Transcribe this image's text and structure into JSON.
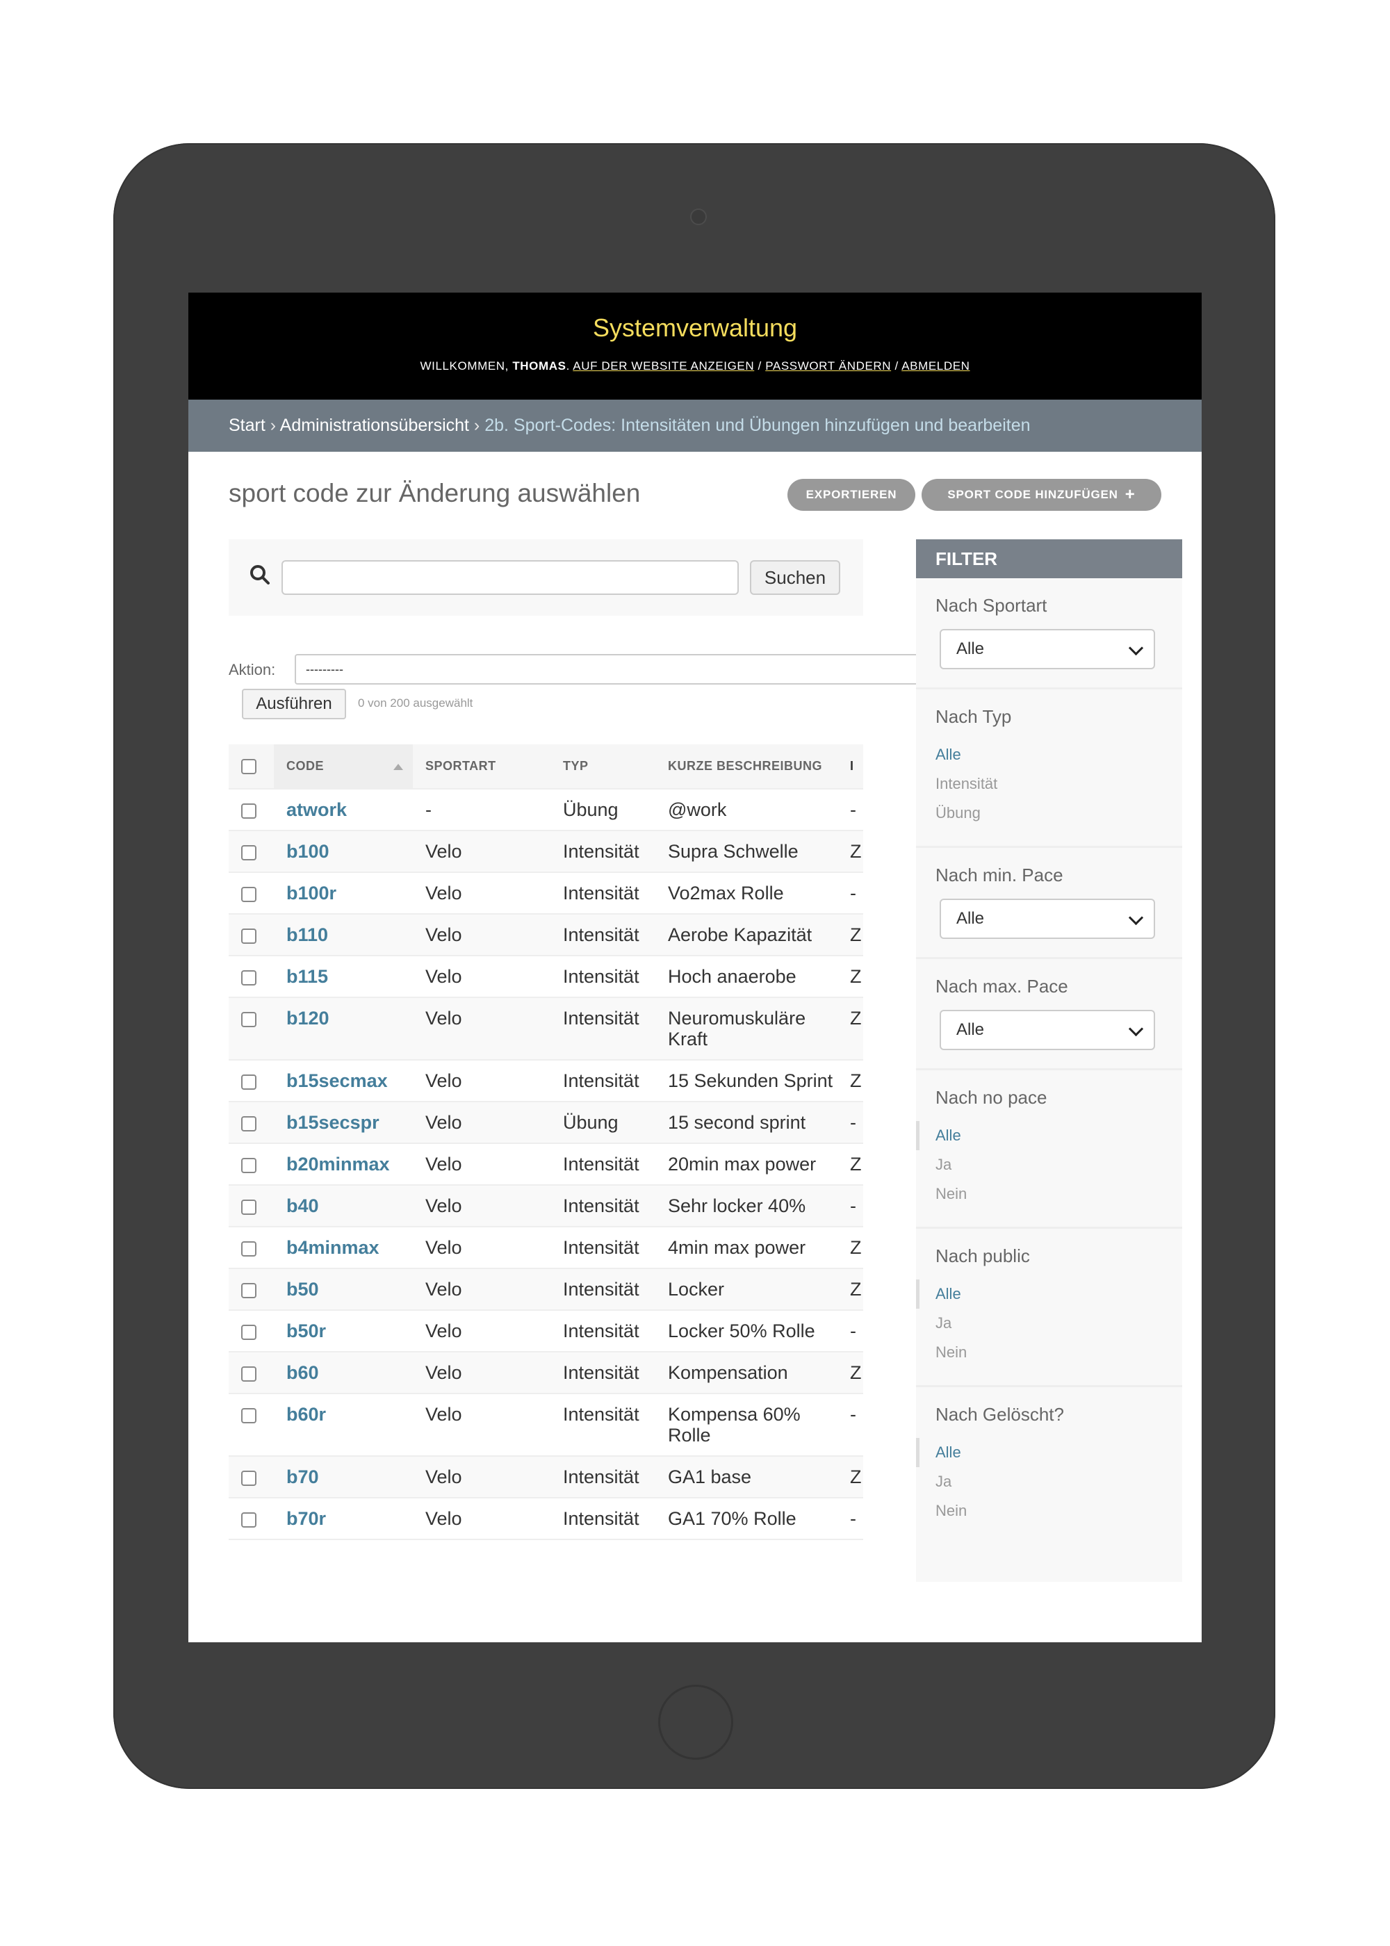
{
  "header": {
    "site_name": "Systemverwaltung",
    "welcome": "WILLKOMMEN, ",
    "username": "THOMAS",
    "after_name": ". ",
    "view_site": "AUF DER WEBSITE ANZEIGEN",
    "sep1": " / ",
    "change_password": "PASSWORT ÄNDERN",
    "sep2": " / ",
    "logout": "ABMELDEN"
  },
  "breadcrumbs": {
    "home": "Start",
    "sep": " › ",
    "app": "Administrationsübersicht",
    "current": "2b. Sport-Codes: Intensitäten und Übungen hinzufügen und bearbeiten"
  },
  "page": {
    "title": "sport code zur Änderung auswählen",
    "export_label": "EXPORTIEREN",
    "add_label": "SPORT CODE HINZUFÜGEN",
    "add_icon": "+"
  },
  "search": {
    "value": "",
    "placeholder": "",
    "button_label": "Suchen"
  },
  "actions": {
    "label": "Aktion:",
    "selected_value": "---------",
    "run_label": "Ausführen",
    "counter": "0 von 200 ausgewählt"
  },
  "table": {
    "headers": [
      "CODE",
      "SPORTART",
      "TYP",
      "KURZE BESCHREIBUNG",
      "I"
    ],
    "rows": [
      {
        "code": "atwork",
        "sport": "-",
        "type": "Übung",
        "desc": "@work",
        "last": "-"
      },
      {
        "code": "b100",
        "sport": "Velo",
        "type": "Intensität",
        "desc": "Supra Schwelle",
        "last": "Z"
      },
      {
        "code": "b100r",
        "sport": "Velo",
        "type": "Intensität",
        "desc": "Vo2max Rolle",
        "last": "-"
      },
      {
        "code": "b110",
        "sport": "Velo",
        "type": "Intensität",
        "desc": "Aerobe Kapazität",
        "last": "Z"
      },
      {
        "code": "b115",
        "sport": "Velo",
        "type": "Intensität",
        "desc": "Hoch anaerobe",
        "last": "Z"
      },
      {
        "code": "b120",
        "sport": "Velo",
        "type": "Intensität",
        "desc": "Neuromuskuläre Kraft",
        "last": "Z"
      },
      {
        "code": "b15secmax",
        "sport": "Velo",
        "type": "Intensität",
        "desc": "15 Sekunden Sprint",
        "last": "Z"
      },
      {
        "code": "b15secspr",
        "sport": "Velo",
        "type": "Übung",
        "desc": "15 second sprint",
        "last": "-"
      },
      {
        "code": "b20minmax",
        "sport": "Velo",
        "type": "Intensität",
        "desc": "20min max power",
        "last": "Z"
      },
      {
        "code": "b40",
        "sport": "Velo",
        "type": "Intensität",
        "desc": "Sehr locker 40%",
        "last": "-"
      },
      {
        "code": "b4minmax",
        "sport": "Velo",
        "type": "Intensität",
        "desc": "4min max power",
        "last": "Z"
      },
      {
        "code": "b50",
        "sport": "Velo",
        "type": "Intensität",
        "desc": "Locker",
        "last": "Z"
      },
      {
        "code": "b50r",
        "sport": "Velo",
        "type": "Intensität",
        "desc": "Locker 50% Rolle",
        "last": "-"
      },
      {
        "code": "b60",
        "sport": "Velo",
        "type": "Intensität",
        "desc": "Kompensation",
        "last": "Z"
      },
      {
        "code": "b60r",
        "sport": "Velo",
        "type": "Intensität",
        "desc": "Kompensa 60% Rolle",
        "last": "-"
      },
      {
        "code": "b70",
        "sport": "Velo",
        "type": "Intensität",
        "desc": "GA1 base",
        "last": "Z"
      },
      {
        "code": "b70r",
        "sport": "Velo",
        "type": "Intensität",
        "desc": "GA1 70% Rolle",
        "last": "-"
      }
    ]
  },
  "filter": {
    "heading": "FILTER",
    "sportart": {
      "title": "Nach Sportart",
      "selected": "Alle"
    },
    "typ": {
      "title": "Nach Typ",
      "options": [
        "Alle",
        "Intensität",
        "Übung"
      ]
    },
    "min_pace": {
      "title": "Nach min. Pace",
      "selected": "Alle"
    },
    "max_pace": {
      "title": "Nach max. Pace",
      "selected": "Alle"
    },
    "no_pace": {
      "title": "Nach no pace",
      "options": [
        "Alle",
        "Ja",
        "Nein"
      ]
    },
    "public": {
      "title": "Nach public",
      "options": [
        "Alle",
        "Ja",
        "Nein"
      ]
    },
    "deleted": {
      "title": "Nach Gelöscht?",
      "options": [
        "Alle",
        "Ja",
        "Nein"
      ]
    }
  }
}
